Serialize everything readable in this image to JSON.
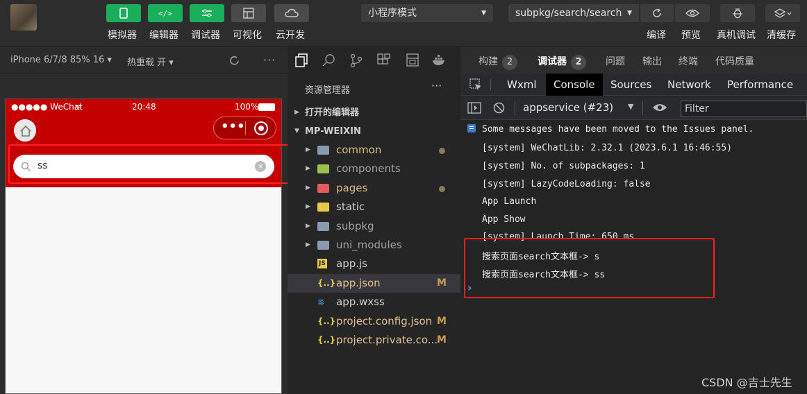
{
  "toolbar": {
    "buttons": [
      {
        "label": "模拟器"
      },
      {
        "label": "编辑器"
      },
      {
        "label": "调试器"
      },
      {
        "label": "可视化"
      },
      {
        "label": "云开发"
      }
    ],
    "mode_select": "小程序模式",
    "path_select": "subpkg/search/search",
    "right_buttons": [
      {
        "label": "编译"
      },
      {
        "label": "预览"
      },
      {
        "label": "真机调试"
      },
      {
        "label": "清缓存"
      }
    ]
  },
  "simulator": {
    "device": "iPhone 6/7/8 85% 16 ▾",
    "hot_reload": "热重载 开 ▾",
    "status": {
      "carrier": "●●●●● WeChat",
      "time": "20:48",
      "battery": "100%"
    },
    "search_value": "ss"
  },
  "explorer": {
    "title": "资源管理器",
    "open_editors": "打开的编辑器",
    "project": "MP-WEIXIN",
    "items": [
      {
        "name": "common",
        "type": "folder",
        "status": "dot"
      },
      {
        "name": "components",
        "type": "folder",
        "status": ""
      },
      {
        "name": "pages",
        "type": "folder",
        "status": "dot"
      },
      {
        "name": "static",
        "type": "folder",
        "status": ""
      },
      {
        "name": "subpkg",
        "type": "folder",
        "status": ""
      },
      {
        "name": "uni_modules",
        "type": "folder",
        "status": ""
      },
      {
        "name": "app.js",
        "type": "js",
        "status": ""
      },
      {
        "name": "app.json",
        "type": "json",
        "status": "M"
      },
      {
        "name": "app.wxss",
        "type": "css",
        "status": ""
      },
      {
        "name": "project.config.json",
        "type": "json",
        "status": "M"
      },
      {
        "name": "project.private.co...",
        "type": "json",
        "status": "M"
      }
    ]
  },
  "devtools": {
    "top_tabs": [
      {
        "label": "构建",
        "count": "2"
      },
      {
        "label": "调试器",
        "count": "2"
      },
      {
        "label": "问题",
        "count": ""
      },
      {
        "label": "输出",
        "count": ""
      },
      {
        "label": "终端",
        "count": ""
      },
      {
        "label": "代码质量",
        "count": ""
      }
    ],
    "panel_tabs": [
      "Wxml",
      "Console",
      "Sources",
      "Network",
      "Performance"
    ],
    "context": "appservice (#23)",
    "filter_placeholder": "Filter",
    "console_lines": [
      "Some messages have been moved to the Issues panel.",
      "[system] WeChatLib: 2.32.1 (2023.6.1 16:46:55)",
      "[system] No. of subpackages: 1",
      "[system] LazyCodeLoading: false",
      "App Launch",
      "App Show",
      "[system] Launch Time: 650 ms",
      "搜索页面search文本框-> s",
      "搜索页面search文本框-> ss"
    ],
    "prompt": "›"
  },
  "watermark": "CSDN @吉士先生",
  "colors": {
    "accent": "#1aad5a",
    "header_red": "#c40000",
    "highlight": "#ff2020"
  }
}
